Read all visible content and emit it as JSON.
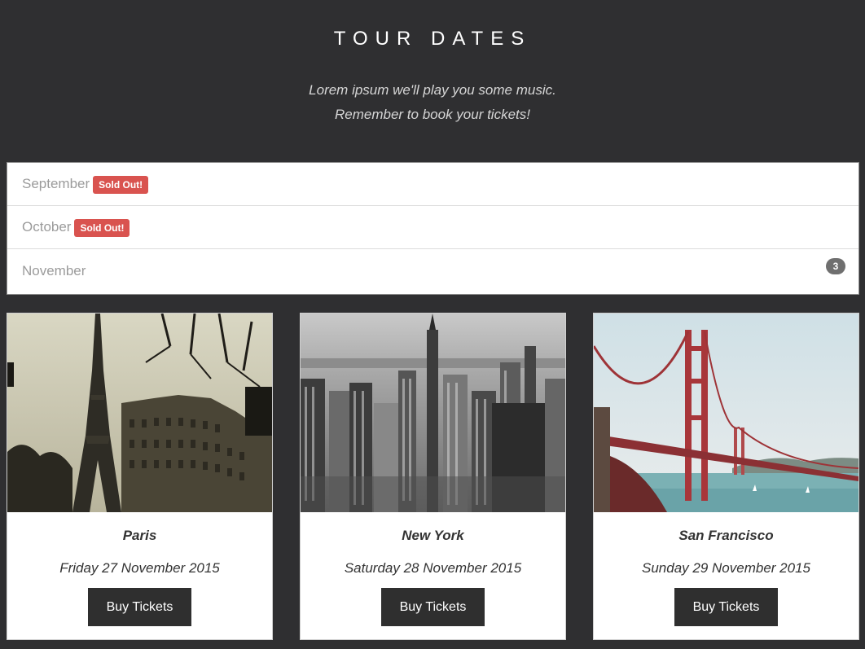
{
  "header": {
    "title": "TOUR DATES",
    "subtitle_line1": "Lorem ipsum we'll play you some music.",
    "subtitle_line2": "Remember to book your tickets!"
  },
  "months": [
    {
      "label": "September",
      "badge": "Sold Out!"
    },
    {
      "label": "October",
      "badge": "Sold Out!"
    },
    {
      "label": "November",
      "count": "3"
    }
  ],
  "cards": [
    {
      "city": "Paris",
      "date": "Friday 27 November 2015",
      "button": "Buy Tickets",
      "photo": "eiffel-tower-photo"
    },
    {
      "city": "New York",
      "date": "Saturday 28 November 2015",
      "button": "Buy Tickets",
      "photo": "new-york-skyline-photo"
    },
    {
      "city": "San Francisco",
      "date": "Sunday 29 November 2015",
      "button": "Buy Tickets",
      "photo": "golden-gate-bridge-photo"
    }
  ],
  "colors": {
    "background": "#2f2f31",
    "badge_sold": "#d9534f",
    "badge_count": "#6f6f6f",
    "button": "#2f2f2f"
  }
}
